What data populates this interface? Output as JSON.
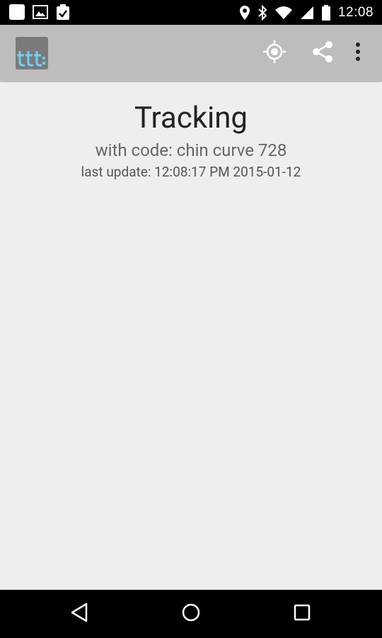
{
  "status_bar": {
    "time": "12:08",
    "left_icons": [
      "notification-square-icon",
      "image-icon",
      "clipboard-check-icon"
    ],
    "right_icons": [
      "location-pin-icon",
      "bluetooth-icon",
      "wifi-icon",
      "cell-signal-icon",
      "battery-icon"
    ]
  },
  "app_bar": {
    "logo_text": "ttt",
    "actions": [
      "my-location-icon",
      "share-icon",
      "overflow-menu-icon"
    ]
  },
  "main": {
    "title": "Tracking",
    "code_line": "with code: chin curve 728",
    "last_update": "last update: 12:08:17 PM 2015-01-12"
  },
  "nav_bar": {
    "buttons": [
      "back-icon",
      "home-icon",
      "recents-icon"
    ]
  },
  "colors": {
    "app_bar_bg": "#bdbdbd",
    "content_bg": "#eeeeee",
    "logo_accent": "#6fd0ff"
  }
}
